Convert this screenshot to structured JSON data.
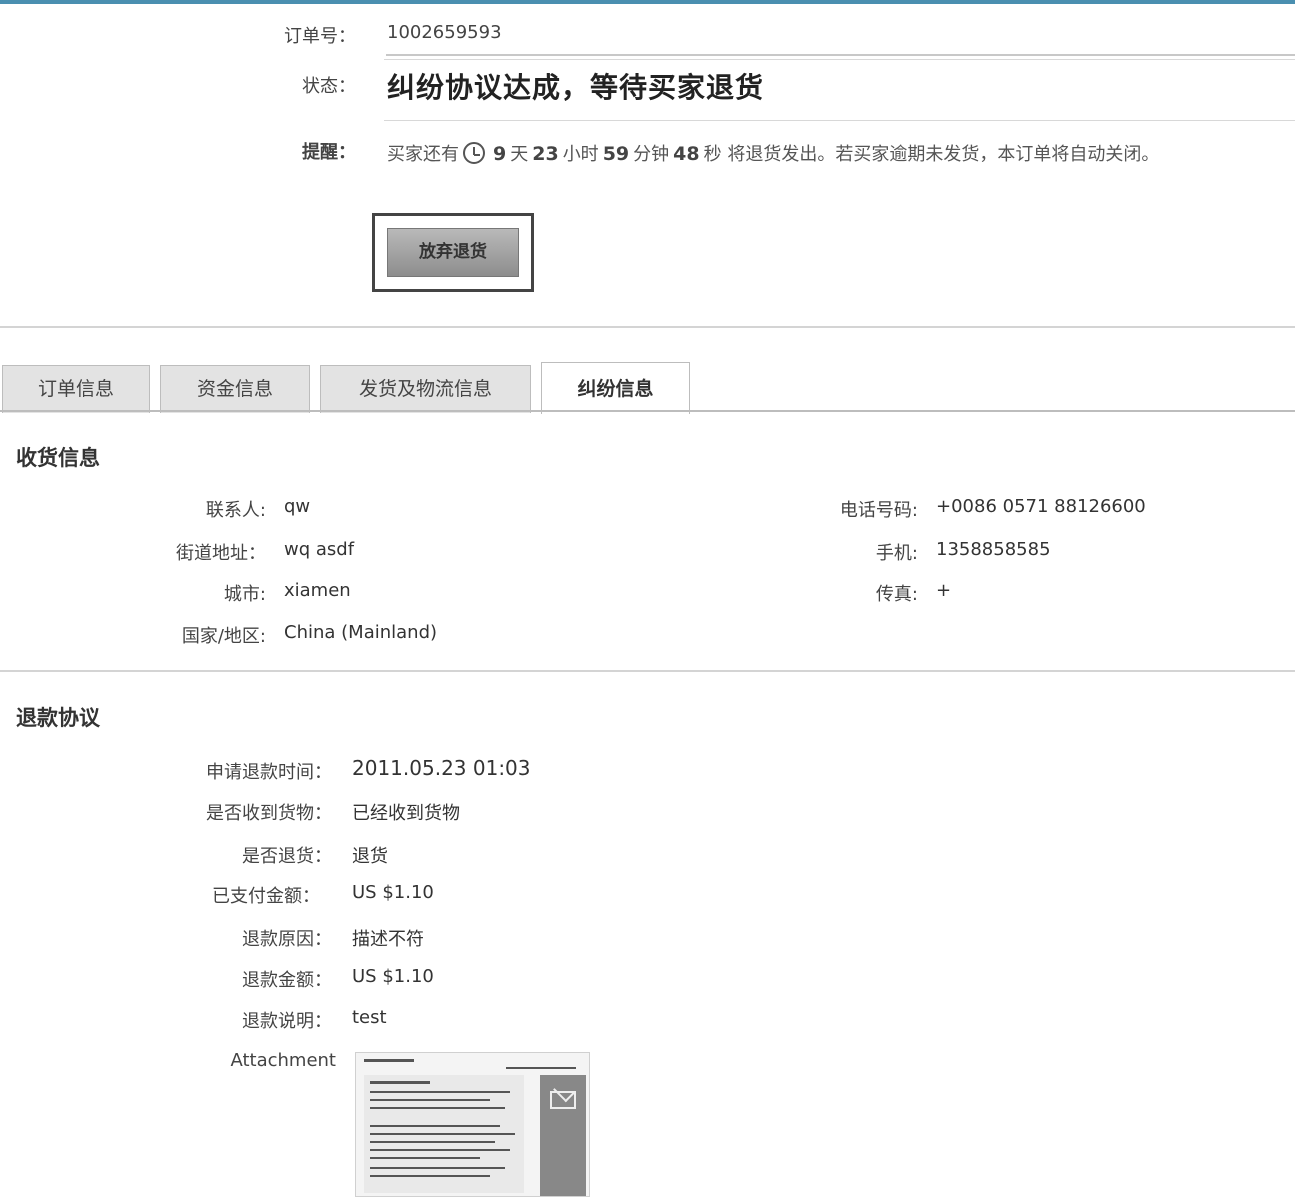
{
  "order": {
    "order_no_label": "订单号：",
    "order_no_value": "1002659593",
    "status_label": "状态：",
    "status_value": "纠纷协议达成，等待买家退货",
    "remind_label": "提醒：",
    "remind_prefix": "买家还有",
    "days": "9",
    "days_unit": "天",
    "hours": "23",
    "hours_unit": "小时",
    "minutes": "59",
    "minutes_unit": "分钟",
    "seconds": "48",
    "seconds_unit": "秒",
    "remind_suffix": "将退货发出。若买家逾期未发货，本订单将自动关闭。",
    "abandon_button": "放弃退货"
  },
  "tabs": [
    {
      "label": "订单信息",
      "active": false
    },
    {
      "label": "资金信息",
      "active": false
    },
    {
      "label": "发货及物流信息",
      "active": false
    },
    {
      "label": "纠纷信息",
      "active": true
    }
  ],
  "shipping": {
    "title": "收货信息",
    "contact_label": "联系人:",
    "contact_value": "qw",
    "street_label": "街道地址：",
    "street_value": "wq asdf",
    "city_label": "城市:",
    "city_value": "xiamen",
    "country_label": "国家/地区:",
    "country_value": "China (Mainland)",
    "phone_label": "电话号码:",
    "phone_value": "+0086 0571 88126600",
    "mobile_label": "手机:",
    "mobile_value": "1358858585",
    "fax_label": "传真:",
    "fax_value": "+"
  },
  "refund": {
    "title": "退款协议",
    "rows": [
      {
        "label": "申请退款时间：",
        "value": "2011.05.23 01:03"
      },
      {
        "label": "是否收到货物：",
        "value": "已经收到货物"
      },
      {
        "label": "是否退货：",
        "value": "退货"
      },
      {
        "label": "已支付金额：",
        "value": "US $1.10"
      },
      {
        "label": "退款原因：",
        "value": "描述不符"
      },
      {
        "label": "退款金额：",
        "value": "US $1.10"
      },
      {
        "label": "退款说明：",
        "value": "test"
      }
    ],
    "attachment_label": "Attachment"
  }
}
